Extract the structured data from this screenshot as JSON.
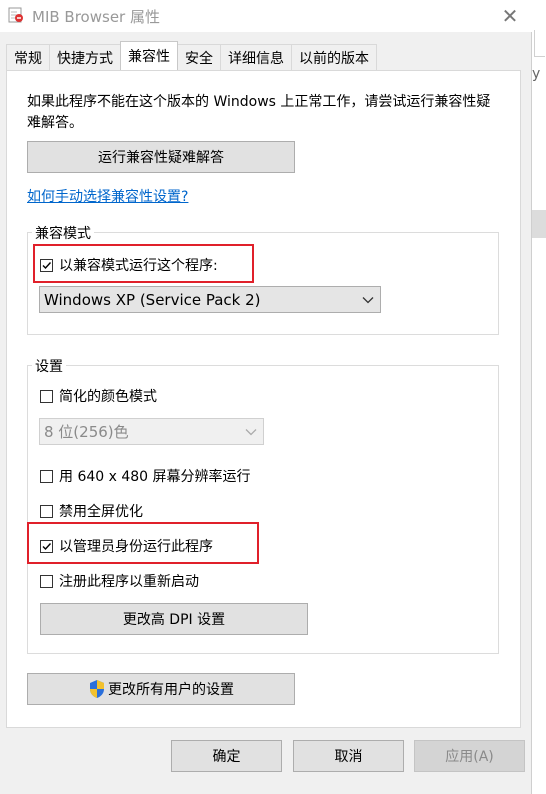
{
  "window": {
    "title": "MIB Browser 属性",
    "close_glyph": "✕"
  },
  "tabs": [
    {
      "label": "常规",
      "active": false
    },
    {
      "label": "快捷方式",
      "active": false
    },
    {
      "label": "兼容性",
      "active": true
    },
    {
      "label": "安全",
      "active": false
    },
    {
      "label": "详细信息",
      "active": false
    },
    {
      "label": "以前的版本",
      "active": false
    }
  ],
  "compat": {
    "intro_text": "如果此程序不能在这个版本的 Windows 上正常工作，请尝试运行兼容性疑难解答。",
    "troubleshoot_button": "运行兼容性疑难解答",
    "manual_link": "如何手动选择兼容性设置?",
    "mode_group_label": "兼容模式",
    "mode_checkbox_label": "以兼容模式运行这个程序:",
    "mode_checkbox_checked": true,
    "os_selected": "Windows XP (Service Pack 2)"
  },
  "settings": {
    "group_label": "设置",
    "reduced_color_label": "简化的颜色模式",
    "reduced_color_checked": false,
    "color_selected": "8 位(256)色",
    "resolution_label": "用 640 x 480 屏幕分辨率运行",
    "resolution_checked": false,
    "fullscreen_opt_label": "禁用全屏优化",
    "fullscreen_opt_checked": false,
    "admin_label": "以管理员身份运行此程序",
    "admin_checked": true,
    "restart_label": "注册此程序以重新启动",
    "restart_checked": false,
    "dpi_button": "更改高 DPI 设置"
  },
  "all_users_button": "更改所有用户的设置",
  "footer": {
    "ok": "确定",
    "cancel": "取消",
    "apply": "应用(A)"
  },
  "behind_window_glyph": "y",
  "colors": {
    "highlight": "#e0202a",
    "link": "#0066cc"
  },
  "icons": [
    "app-icon",
    "close-icon",
    "chevron-down-icon",
    "shield-icon",
    "checkmark-icon"
  ]
}
